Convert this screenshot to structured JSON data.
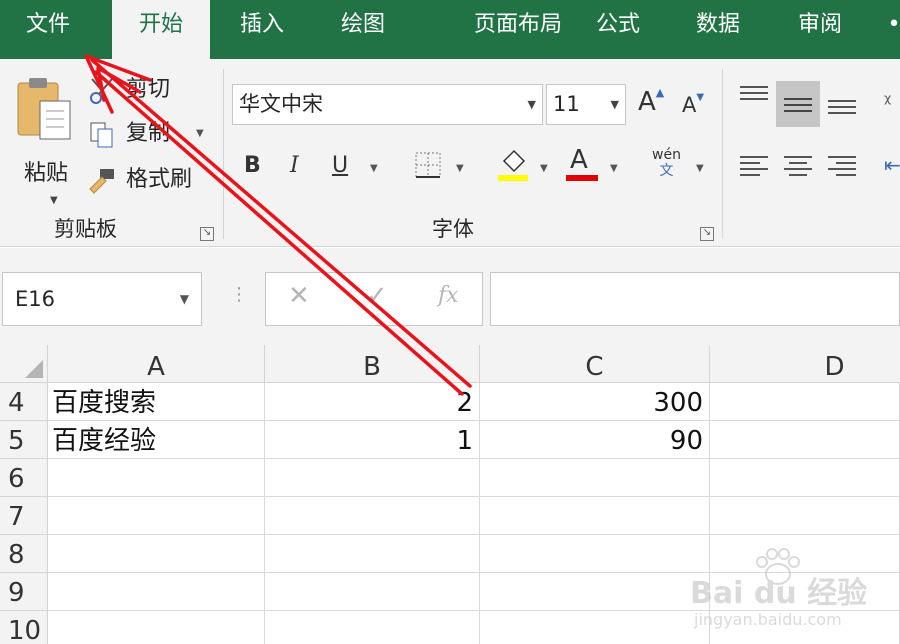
{
  "tabs": [
    "文件",
    "开始",
    "插入",
    "绘图",
    "页面布局",
    "公式",
    "数据",
    "审阅"
  ],
  "ribbon": {
    "paste_label": "粘贴",
    "cut_label": "剪切",
    "copy_label": "复制",
    "format_painter_label": "格式刷",
    "clipboard_group": "剪贴板",
    "font_name": "华文中宋",
    "font_size": "11",
    "bold": "B",
    "italic": "I",
    "underline": "U",
    "font_color_letter": "A",
    "grow_font": "A",
    "shrink_font": "A",
    "phonetic_top": "wén",
    "phonetic_bottom": "文",
    "font_group": "字体",
    "highlight_color": "#ffff00",
    "font_color": "#e00000"
  },
  "formula_bar": {
    "name_box": "E16",
    "cancel": "✕",
    "confirm": "✓",
    "fx": "fx",
    "formula": ""
  },
  "sheet": {
    "columns": [
      "A",
      "B",
      "C",
      "D"
    ],
    "rows": [
      {
        "num": "4",
        "A": "百度搜索",
        "B": "2",
        "C": "300",
        "D": ""
      },
      {
        "num": "5",
        "A": "百度经验",
        "B": "1",
        "C": "90",
        "D": ""
      },
      {
        "num": "6",
        "A": "",
        "B": "",
        "C": "",
        "D": ""
      },
      {
        "num": "7",
        "A": "",
        "B": "",
        "C": "",
        "D": ""
      },
      {
        "num": "8",
        "A": "",
        "B": "",
        "C": "",
        "D": ""
      },
      {
        "num": "9",
        "A": "",
        "B": "",
        "C": "",
        "D": ""
      },
      {
        "num": "10",
        "A": "",
        "B": "",
        "C": "",
        "D": ""
      }
    ]
  },
  "watermark": {
    "brand": "Bai du 经验",
    "url": "jingyan.baidu.com"
  },
  "colors": {
    "excel_green": "#217346",
    "annotation_arrow": "#e8141b"
  }
}
